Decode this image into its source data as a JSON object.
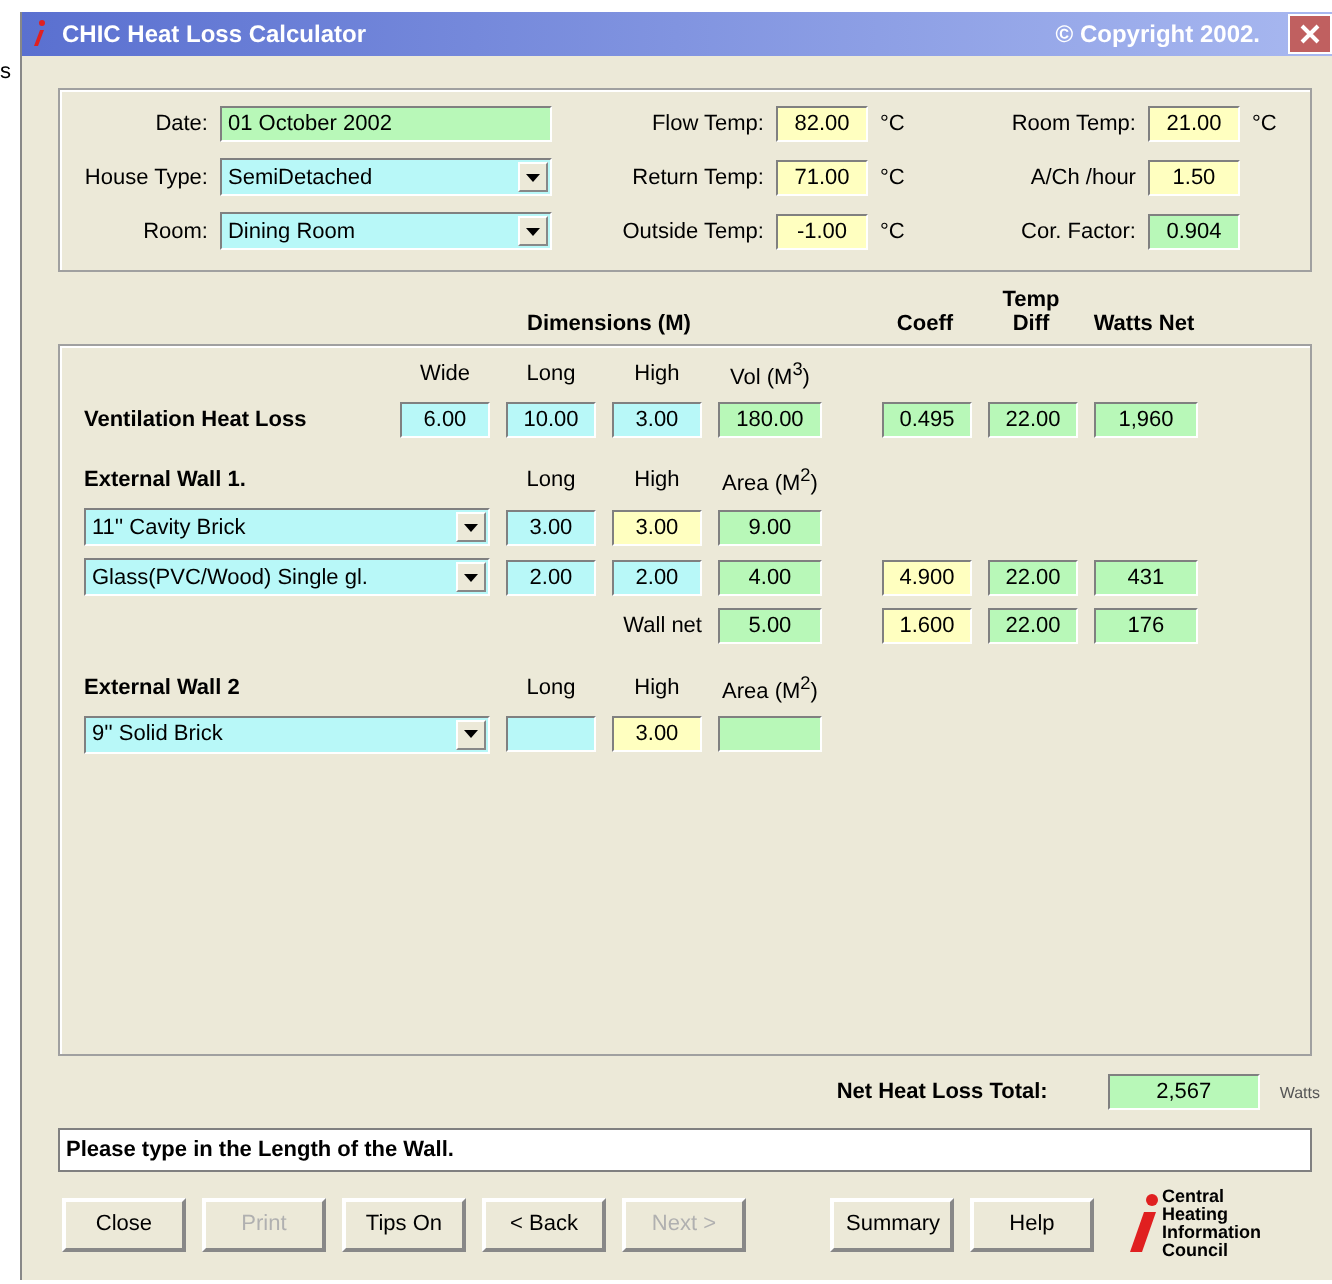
{
  "background_text": "s",
  "window": {
    "title": "CHIC Heat Loss Calculator",
    "copyright": "© Copyright 2002."
  },
  "details": {
    "left": [
      {
        "label": "Date:",
        "value": "01 October 2002",
        "color": "#b8f8b8",
        "kind": "text"
      },
      {
        "label": "House Type:",
        "value": "SemiDetached",
        "color": "#b8f8f8",
        "kind": "combo"
      },
      {
        "label": "Room:",
        "value": "Dining Room",
        "color": "#b8f8f8",
        "kind": "combo"
      }
    ],
    "middle": [
      {
        "label": "Flow Temp:",
        "value": "82.00",
        "unit": "°C",
        "color": "#ffffc0"
      },
      {
        "label": "Return Temp:",
        "value": "71.00",
        "unit": "°C",
        "color": "#ffffc0"
      },
      {
        "label": "Outside Temp:",
        "value": "-1.00",
        "unit": "°C",
        "color": "#ffffc0"
      }
    ],
    "right": [
      {
        "label": "Room Temp:",
        "value": "21.00",
        "unit": "°C",
        "color": "#ffffc0"
      },
      {
        "label": "A/Ch /hour",
        "value": "1.50",
        "color": "#ffffc0"
      },
      {
        "label": "Cor. Factor:",
        "value": "0.904",
        "color": "#b8f8b8"
      }
    ]
  },
  "columns": {
    "dimensions": "Dimensions  (M)",
    "coeff": "Coeff",
    "temp_diff": "Temp Diff",
    "watts_net": "Watts Net"
  },
  "sections": [
    {
      "kind": "ventilation",
      "title": "Ventilation Heat Loss",
      "headings": [
        "Wide",
        "Long",
        "High",
        "Vol (M$^{3}$)"
      ],
      "rows": [
        {
          "kind": "values",
          "wide": {
            "value": "6.00",
            "color": "#b8f8f8"
          },
          "long": {
            "value": "10.00",
            "color": "#b8f8f8"
          },
          "high": {
            "value": "3.00",
            "color": "#b8f8f8"
          },
          "volume": {
            "value": "180.00",
            "color": "#b8f8b8"
          },
          "coeff": {
            "value": "0.495",
            "color": "#b8f8b8"
          },
          "temp_diff": {
            "value": "22.00",
            "color": "#b8f8b8"
          },
          "watts": {
            "value": "1,960",
            "color": "#b8f8b8"
          }
        }
      ]
    },
    {
      "kind": "wall",
      "title": "External Wall 1.",
      "headings": [
        "Long",
        "High",
        "Area (M$^{2}$)"
      ],
      "rows": [
        {
          "kind": "select",
          "select": {
            "value": "11'' Cavity Brick",
            "color": "#b8f8f8"
          },
          "long": {
            "value": "3.00",
            "color": "#b8f8f8"
          },
          "high": {
            "value": "3.00",
            "color": "#ffffc0"
          },
          "volume": {
            "value": "9.00",
            "color": "#b8f8b8"
          }
        },
        {
          "kind": "select",
          "select": {
            "value": "Glass(PVC/Wood) Single gl.",
            "color": "#b8f8f8"
          },
          "long": {
            "value": "2.00",
            "color": "#b8f8f8"
          },
          "high": {
            "value": "2.00",
            "color": "#b8f8f8"
          },
          "volume": {
            "value": "4.00",
            "color": "#b8f8b8"
          },
          "coeff": {
            "value": "4.900",
            "color": "#ffffc0"
          },
          "temp_diff": {
            "value": "22.00",
            "color": "#b8f8b8"
          },
          "watts": {
            "value": "431",
            "color": "#b8f8b8"
          }
        },
        {
          "kind": "net",
          "label": "Wall net",
          "volume": {
            "value": "5.00",
            "color": "#b8f8b8"
          },
          "coeff": {
            "value": "1.600",
            "color": "#ffffc0"
          },
          "temp_diff": {
            "value": "22.00",
            "color": "#b8f8b8"
          },
          "watts": {
            "value": "176",
            "color": "#b8f8b8"
          }
        }
      ]
    },
    {
      "kind": "wall",
      "title": "External Wall  2",
      "headings": [
        "Long",
        "High",
        "Area (M$^{2}$)"
      ],
      "rows": [
        {
          "kind": "select",
          "select": {
            "value": "9'' Solid Brick",
            "color": "#b8f8f8"
          },
          "long": {
            "color": "#b8f8f8"
          },
          "high": {
            "value": "3.00",
            "color": "#ffffc0"
          },
          "volume": {
            "color": "#b8f8b8"
          }
        }
      ]
    }
  ],
  "total": {
    "label": "Net Heat Loss Total:",
    "value": "2,567",
    "unit": "Watts",
    "color": "#b8f8b8"
  },
  "status": "Please type in the Length of the Wall.",
  "buttons": [
    {
      "label": "Close",
      "disabled": false
    },
    {
      "label": "Print",
      "disabled": true
    },
    {
      "label": "Tips On",
      "disabled": false
    },
    {
      "label": "< Back",
      "disabled": false
    },
    {
      "label": "Next >",
      "disabled": true
    }
  ],
  "buttons_right": [
    {
      "label": "Summary",
      "disabled": false
    },
    {
      "label": "Help",
      "disabled": false
    }
  ],
  "logo": [
    "Central",
    "Heating",
    "Information",
    "Council"
  ]
}
